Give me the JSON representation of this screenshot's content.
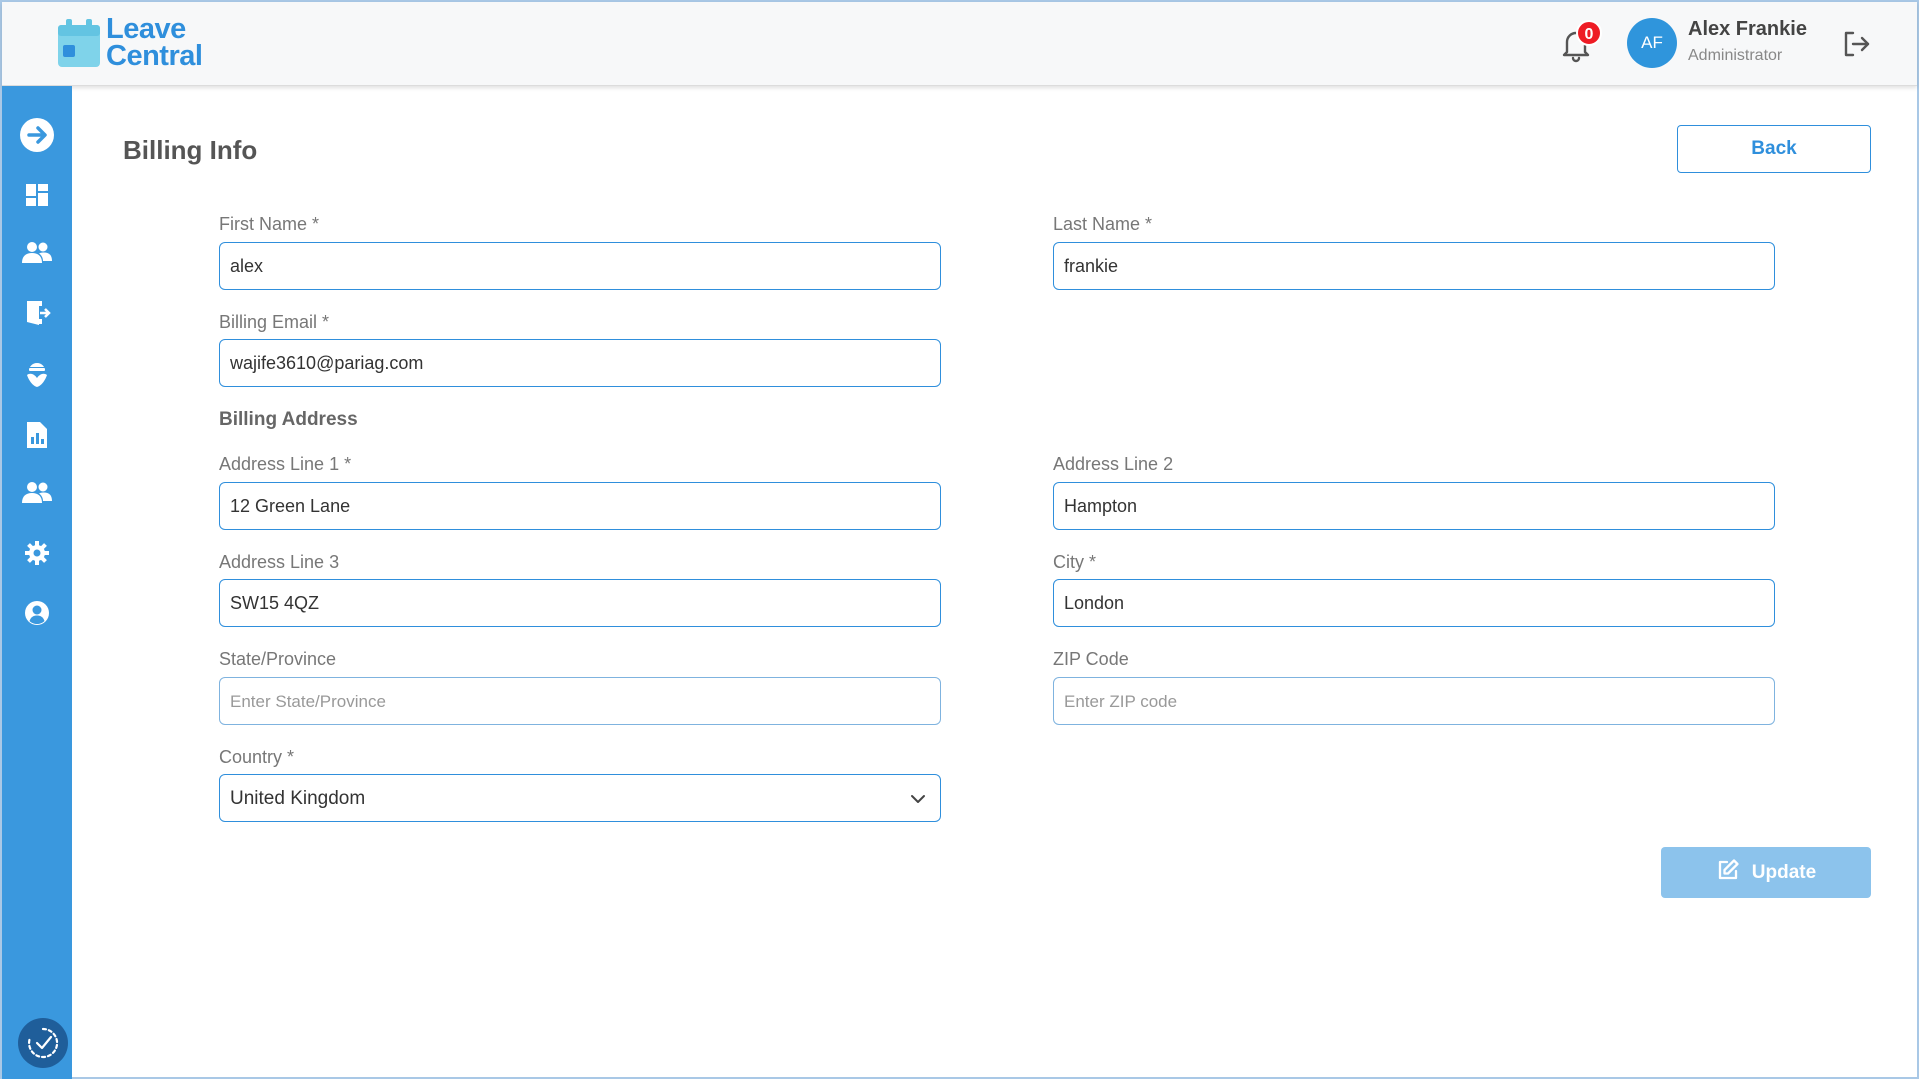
{
  "header": {
    "logo_line1": "Leave",
    "logo_line2": "Central",
    "notification_count": "0",
    "avatar_initials": "AF",
    "user_name": "Alex Frankie",
    "user_role": "Administrator"
  },
  "sidebar": {
    "icons": [
      "arrow-right-circle-icon",
      "dashboard-icon",
      "users-icon",
      "exit-door-icon",
      "plant-icon",
      "report-icon",
      "team-icon",
      "gear-icon",
      "user-circle-icon"
    ],
    "bottom_icon": "clock-check-icon"
  },
  "page": {
    "title": "Billing Info",
    "back_label": "Back",
    "update_label": "Update"
  },
  "form": {
    "first_name": {
      "label": "First Name *",
      "value": "alex"
    },
    "last_name": {
      "label": "Last Name *",
      "value": "frankie"
    },
    "billing_email": {
      "label": "Billing Email *",
      "value": "wajife3610@pariag.com"
    },
    "billing_address_title": "Billing Address",
    "address_line1": {
      "label": "Address Line 1 *",
      "value": "12 Green Lane"
    },
    "address_line2": {
      "label": "Address Line 2",
      "value": "Hampton"
    },
    "address_line3": {
      "label": "Address Line 3",
      "value": "SW15 4QZ"
    },
    "city": {
      "label": "City *",
      "value": "London"
    },
    "state": {
      "label": "State/Province",
      "placeholder": "Enter State/Province"
    },
    "zip": {
      "label": "ZIP Code",
      "placeholder": "Enter ZIP code"
    },
    "country": {
      "label": "Country *",
      "value": "United Kingdom"
    }
  },
  "colors": {
    "accent": "#2f8fdc",
    "sidebar": "#3a98de",
    "badge": "#ee1c25",
    "update_disabled": "#8cc3ec"
  }
}
